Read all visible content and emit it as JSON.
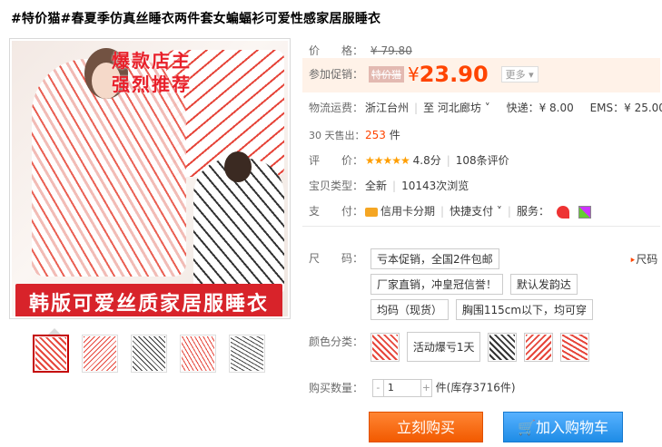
{
  "title": "#特价猫#春夏季仿真丝睡衣两件套女蝙蝠衫可爱性感家居服睡衣",
  "main_image": {
    "promo_line1": "爆款店主",
    "promo_line2": "强烈推荐",
    "banner": "韩版可爱丝质家居服睡衣"
  },
  "thumbnails_count": 5,
  "price": {
    "label": "价　　格：",
    "currency": "¥",
    "original": "79.80"
  },
  "promotion": {
    "label": "参加促销：",
    "tag": "特价猫",
    "currency": "¥",
    "price": "23.90",
    "more": "更多"
  },
  "shipping": {
    "label": "物流运费：",
    "from": "浙江台州",
    "to_sep": "至",
    "to": "河北廊坊",
    "express": "快递：¥ 8.00",
    "ems": "EMS：¥ 25.00"
  },
  "sales": {
    "label": "30 天售出：",
    "count": "253",
    "unit": "件"
  },
  "rating": {
    "label": "评　　价：",
    "stars": "★★★★★",
    "score": "4.8分",
    "reviews": "108条评价"
  },
  "item_type": {
    "label": "宝贝类型：",
    "condition": "全新",
    "views": "10143次浏览"
  },
  "payment": {
    "label": "支　　付：",
    "credit": "信用卡分期",
    "quick": "快捷支付",
    "service_label": "服务："
  },
  "size": {
    "label": "尺　　码：",
    "size_chart": "尺码",
    "options": [
      "亏本促销，全国2件包邮",
      "厂家直销，冲皇冠信誉！",
      "默认发韵达",
      "均码（现货）",
      "胸围115cm以下，均可穿"
    ]
  },
  "color": {
    "label": "颜色分类：",
    "text_option": "活动爆亏1天"
  },
  "quantity": {
    "label": "购买数量：",
    "minus": "-",
    "value": "1",
    "plus": "+",
    "unit": "件",
    "stock": "(库存3716件)"
  },
  "buttons": {
    "buy": "立刻购买",
    "cart": "加入购物车"
  },
  "colors": {
    "accent": "#ff4400",
    "buy": "#f25a00",
    "cart": "#1e8ce6"
  }
}
